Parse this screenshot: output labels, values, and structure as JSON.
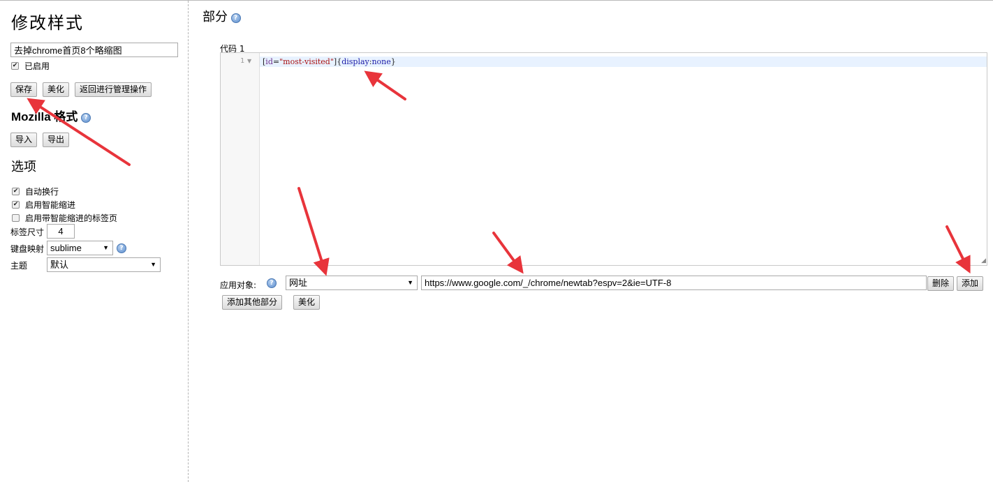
{
  "sidebar": {
    "title": "修改样式",
    "style_name_value": "去掉chrome首页8个略缩图",
    "enabled_label": "已启用",
    "save_label": "保存",
    "beautify_label": "美化",
    "back_label": "返回进行管理操作",
    "mozilla_title": "Mozilla 格式",
    "import_label": "导入",
    "export_label": "导出",
    "options_title": "选项",
    "options": {
      "wrap_label": "自动换行",
      "smart_indent_label": "启用智能缩进",
      "smart_indent_tabs_label": "启用带智能缩进的标签页",
      "tab_size_label": "标签尺寸",
      "tab_size_value": "4",
      "keymap_label": "键盘映射",
      "keymap_value": "sublime",
      "theme_label": "主题",
      "theme_value": "默认"
    }
  },
  "main": {
    "section_title": "部分",
    "code_label": "代码 1",
    "line_number": "1",
    "code": {
      "selector_open": "[",
      "attr_name": "id",
      "eq": "=",
      "attr_value": "\"most-visited\"",
      "selector_close": "]",
      "brace_open": "{",
      "prop_name": "display",
      "colon": ":",
      "prop_value": "none",
      "brace_close": "}"
    },
    "apply_to_label": "应用对象:",
    "apply_type_value": "网址",
    "apply_url_value": "https://www.google.com/_/chrome/newtab?espv=2&ie=UTF-8",
    "delete_label": "删除",
    "add_label": "添加",
    "add_section_label": "添加其他部分",
    "beautify_label": "美化"
  },
  "icons": {
    "help": "help-icon",
    "checkbox_check": "check-icon",
    "dropdown": "chevron-down-icon",
    "fold": "fold-arrow-icon",
    "resize": "resize-handle-icon",
    "annotation": "annotation-arrow-icon"
  },
  "colors": {
    "annotation_arrow": "#e8343b",
    "active_line": "#e8f2ff",
    "help_icon": "#5b8ccd"
  }
}
